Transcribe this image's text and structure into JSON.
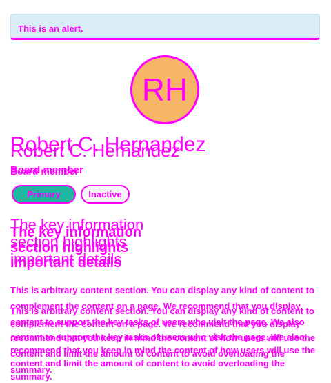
{
  "alert": {
    "text": "This is an alert."
  },
  "profile": {
    "initials": "RH",
    "name": "Robert C. Hernandez",
    "role": "Board member"
  },
  "badges": {
    "primary": "Primary",
    "secondary": "Inactive"
  },
  "section": {
    "heading": "The key information section highlights important details",
    "body": "This is arbitrary content section. You can display any kind of content to complement the content on a page. We recommend that you display content to support the key tasks of users who visit the page. We also recommend that you keep in mind the content of how users will use the content and limit the amount of content to avoid overloading the summary."
  },
  "colors": {
    "alert_bg": "#d9edf7",
    "avatar_bg": "#f7b566",
    "badge_primary_bg": "#1fb7a0",
    "badge_secondary_bg": "#f4f4f4",
    "debug_outline": "#ff00ff"
  }
}
